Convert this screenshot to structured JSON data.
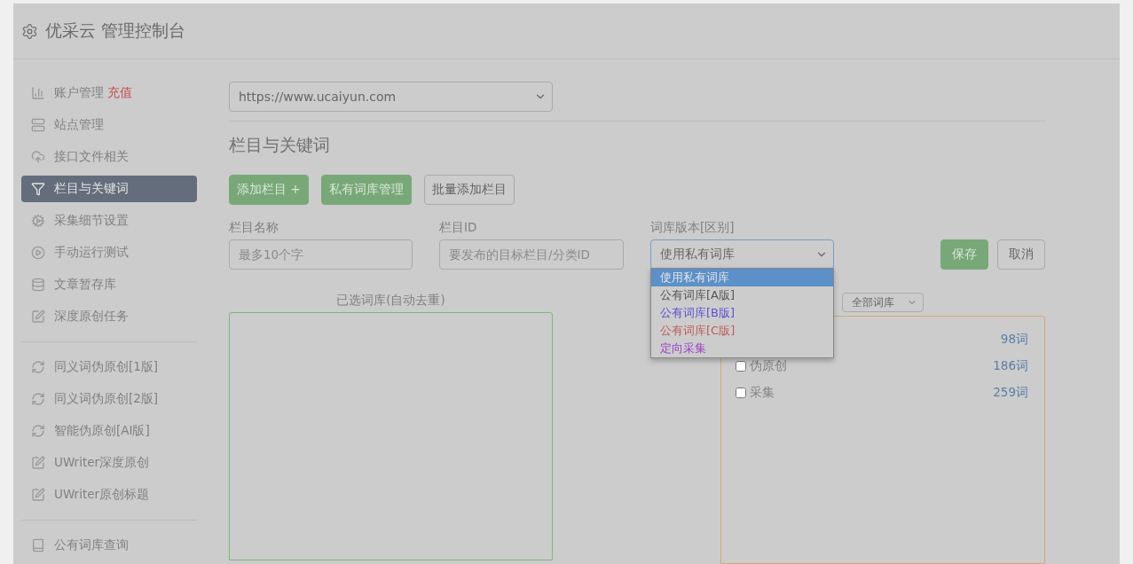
{
  "header": {
    "title": "优采云 管理控制台"
  },
  "sidebar": {
    "groups": [
      [
        {
          "label": "账户管理",
          "badge": "充值",
          "selected": false
        },
        {
          "label": "站点管理",
          "selected": false
        },
        {
          "label": "接口文件相关",
          "selected": false
        },
        {
          "label": "栏目与关键词",
          "selected": true
        },
        {
          "label": "采集细节设置",
          "selected": false
        },
        {
          "label": "手动运行测试",
          "selected": false
        },
        {
          "label": "文章暂存库",
          "selected": false
        },
        {
          "label": "深度原创任务",
          "selected": false
        }
      ],
      [
        {
          "label": "同义词伪原创[1版]",
          "selected": false
        },
        {
          "label": "同义词伪原创[2版]",
          "selected": false
        },
        {
          "label": "智能伪原创[AI版]",
          "selected": false
        },
        {
          "label": "UWriter深度原创",
          "selected": false
        },
        {
          "label": "UWriter原创标题",
          "selected": false
        }
      ],
      [
        {
          "label": "公有词库查询",
          "selected": false
        }
      ]
    ]
  },
  "site_select": {
    "value": "https://www.ucaiyun.com"
  },
  "section_title": "栏目与关键词",
  "toolbar": [
    {
      "label": "添加栏目 +",
      "kind": "primary"
    },
    {
      "label": "私有词库管理",
      "kind": "primary"
    },
    {
      "label": "批量添加栏目",
      "kind": "default"
    }
  ],
  "form": {
    "name": {
      "label": "栏目名称",
      "placeholder": "最多10个字"
    },
    "id": {
      "label": "栏目ID",
      "placeholder": "要发布的目标栏目/分类ID"
    },
    "version": {
      "label": "词库版本[区别]",
      "value": "使用私有词库",
      "expanded": true,
      "options": [
        {
          "label": "使用私有词库",
          "selected": true
        },
        {
          "label": "公有词库[A版]",
          "selected": false,
          "color": "#555555"
        },
        {
          "label": "公有词库[B版]",
          "selected": false,
          "color": "#5a4fd0"
        },
        {
          "label": "公有词库[C版]",
          "selected": false,
          "color": "#c05a5a"
        },
        {
          "label": "定向采集",
          "selected": false,
          "color": "#9a3fc8"
        }
      ]
    },
    "save": "保存",
    "cancel": "取消"
  },
  "selected_panel": {
    "title": "已选词库(自动去重)"
  },
  "library_panel": {
    "filter": "全部词库",
    "rows": [
      {
        "count": "98词"
      },
      {
        "label": "伪原创",
        "count": "186词",
        "checked": false
      },
      {
        "label": "采集",
        "count": "259词",
        "checked": false
      }
    ]
  }
}
